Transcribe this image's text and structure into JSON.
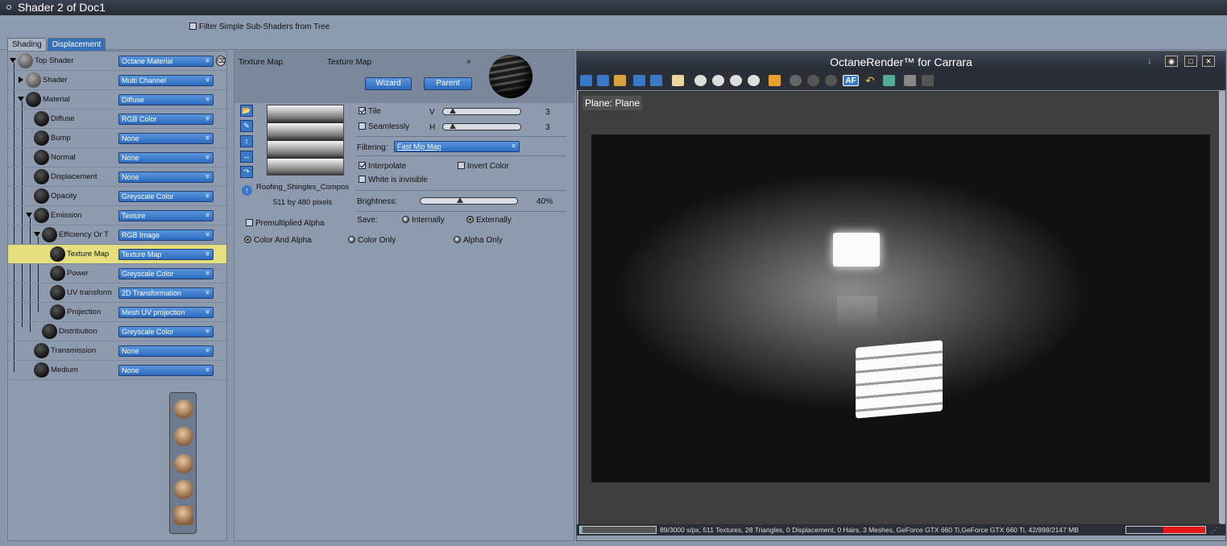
{
  "window": {
    "title": "Shader 2 of Doc1"
  },
  "filter": {
    "label": "Filter Simple Sub-Shaders from Tree",
    "checked": false
  },
  "tabs": [
    {
      "label": "Shading",
      "active": true
    },
    {
      "label": "Displacement",
      "active": false
    }
  ],
  "tree": [
    {
      "label": "Top Shader",
      "value": "Octane Material"
    },
    {
      "label": "Shader",
      "value": "Multi Channel"
    },
    {
      "label": "Material",
      "value": "Diffuse"
    },
    {
      "label": "Diffuse",
      "value": "RGB Color"
    },
    {
      "label": "Bump",
      "value": "None"
    },
    {
      "label": "Normal",
      "value": "None"
    },
    {
      "label": "Displacement",
      "value": "None"
    },
    {
      "label": "Opacity",
      "value": "Greyscale Color"
    },
    {
      "label": "Emission",
      "value": "Texture"
    },
    {
      "label": "Efficiency Or T",
      "value": "RGB Image"
    },
    {
      "label": "Texture Map",
      "value": "Texture Map",
      "selected": true
    },
    {
      "label": "Power",
      "value": "Greyscale Color"
    },
    {
      "label": "UV transform",
      "value": "2D Transformation"
    },
    {
      "label": "Projection",
      "value": "Mesh UV projection"
    },
    {
      "label": "Distribution",
      "value": "Greyscale Color"
    },
    {
      "label": "Transmission",
      "value": "None"
    },
    {
      "label": "Medium",
      "value": "None"
    }
  ],
  "editor": {
    "label": "Texture Map",
    "type": "Texture Map",
    "wizard": "Wizard",
    "parent": "Parent",
    "filename": "Roofing_Shingles_Compos",
    "dimensions": "511 by 480 pixels",
    "tile": {
      "label": "Tile",
      "checked": true,
      "axis": "V",
      "value": "3"
    },
    "seamlessly": {
      "label": "Seamlessly",
      "checked": false,
      "axis": "H",
      "value": "3"
    },
    "filtering_label": "Filtering:",
    "filtering_value": "Fast Mip Map",
    "interpolate": {
      "label": "Interpolate",
      "checked": true
    },
    "invert_color": {
      "label": "Invert Color",
      "checked": false
    },
    "white_invisible": {
      "label": "White is invisible",
      "checked": false
    },
    "brightness_label": "Brightness:",
    "brightness_value": "40%",
    "brightness": 0.4,
    "save_label": "Save:",
    "save_internally": "Internally",
    "save_externally": "Externally",
    "premultiplied": {
      "label": "Premultiplied Alpha",
      "checked": false
    },
    "color_and_alpha": "Color And Alpha",
    "color_only": "Color Only",
    "alpha_only": "Alpha Only"
  },
  "render": {
    "title": "OctaneRender™ for Carrara",
    "af_label": "AF",
    "object_label": "Plane: Plane",
    "status": "89/3000 s/px, 511 Textures, 28 Triangles, 0 Displacement, 0 Hairs, 3 Meshes, GeForce GTX 660 Ti,GeForce GTX 660 Ti, 42/998/2147 MB",
    "progress": 0.03,
    "memory": 0.53
  }
}
